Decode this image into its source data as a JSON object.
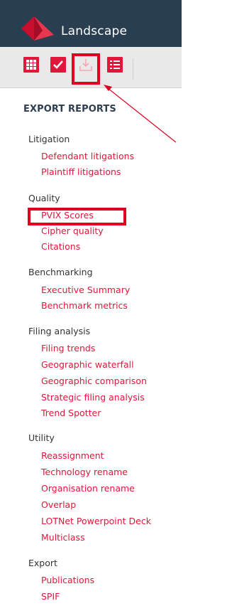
{
  "header": {
    "title": "Landscape"
  },
  "toolbar": {
    "buttons": [
      {
        "icon": "grid-icon"
      },
      {
        "icon": "checkmark-icon"
      },
      {
        "icon": "download-icon"
      },
      {
        "icon": "list-icon"
      }
    ]
  },
  "panel": {
    "title": "EXPORT REPORTS",
    "groups": [
      {
        "heading": "Litigation",
        "items": [
          "Defendant litigations",
          "Plaintiff litigations"
        ]
      },
      {
        "heading": "Quality",
        "items": [
          "PVIX Scores",
          "Cipher quality",
          "Citations"
        ]
      },
      {
        "heading": "Benchmarking",
        "items": [
          "Executive Summary",
          "Benchmark metrics"
        ]
      },
      {
        "heading": "Filing analysis",
        "items": [
          "Filing trends",
          "Geographic waterfall",
          "Geographic comparison",
          "Strategic filing analysis",
          "Trend Spotter"
        ]
      },
      {
        "heading": "Utility",
        "items": [
          "Reassignment",
          "Technology rename",
          "Organisation rename",
          "Overlap",
          "LOTNet Powerpoint Deck",
          "Multiclass"
        ]
      },
      {
        "heading": "Export",
        "items": [
          "Publications",
          "SPIF"
        ]
      }
    ]
  },
  "colors": {
    "header_bg": "#2a3e52",
    "accent": "#e0173a",
    "annotation": "#e00020"
  }
}
